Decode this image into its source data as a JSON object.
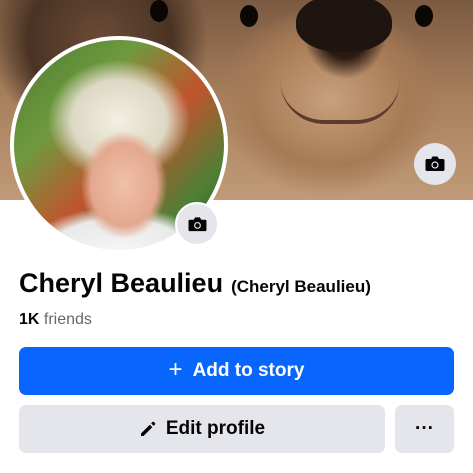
{
  "profile": {
    "name": "Cheryl Beaulieu",
    "alternate_name": "(Cheryl Beaulieu)",
    "friends_count": "1K",
    "friends_label": "friends"
  },
  "actions": {
    "add_to_story_label": "Add to story",
    "edit_profile_label": "Edit profile",
    "more_label": "···"
  },
  "icons": {
    "cover_camera": "camera-icon",
    "avatar_camera": "camera-icon",
    "add": "plus-icon",
    "edit": "pencil-icon"
  },
  "colors": {
    "primary_button": "#0866ff",
    "secondary_button": "#e4e6eb",
    "text_primary": "#050505",
    "text_secondary": "#65676b"
  }
}
